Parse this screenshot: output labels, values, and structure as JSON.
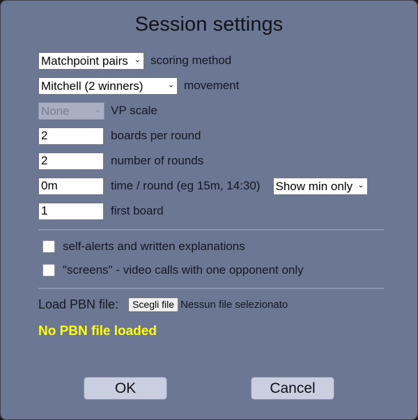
{
  "dialog": {
    "title": "Session settings",
    "background_color": "#6b7793",
    "accent_status_color": "#ffff00"
  },
  "form": {
    "scoring": {
      "value": "Matchpoint pairs",
      "label": "scoring method",
      "chevron": "⌄"
    },
    "movement": {
      "value": "Mitchell (2 winners)",
      "label": "movement",
      "chevron": "⌄"
    },
    "vp_scale": {
      "value": "None",
      "label": "VP scale",
      "chevron": "⌄",
      "disabled": true
    },
    "boards_per_round": {
      "value": "2",
      "label": "boards per round"
    },
    "number_of_rounds": {
      "value": "2",
      "label": "number of rounds"
    },
    "time_per_round": {
      "value": "0m",
      "label": "time / round (eg 15m, 14:30)",
      "mode_value": "Show min only",
      "chevron": "⌄"
    },
    "first_board": {
      "value": "1",
      "label": "first board"
    }
  },
  "options": {
    "self_alerts": {
      "label": "self-alerts and written explanations",
      "checked": false
    },
    "screens": {
      "label": "\"screens\" - video calls with one opponent only",
      "checked": false
    }
  },
  "pbn": {
    "load_label": "Load PBN file:",
    "choose_button": "Scegli file",
    "file_status": "Nessun file selezionato",
    "status_message": "No PBN file loaded"
  },
  "buttons": {
    "ok": "OK",
    "cancel": "Cancel"
  }
}
